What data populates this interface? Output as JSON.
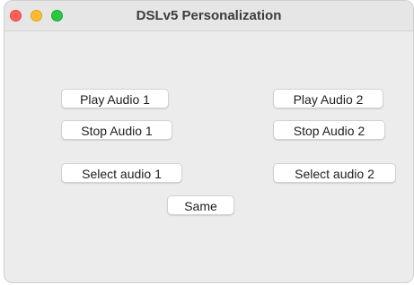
{
  "window": {
    "title": "DSLv5 Personalization"
  },
  "buttons": {
    "play_audio_1": "Play Audio 1",
    "play_audio_2": "Play Audio 2",
    "stop_audio_1": "Stop Audio 1",
    "stop_audio_2": "Stop Audio 2",
    "select_audio_1": "Select audio 1",
    "select_audio_2": "Select audio 2",
    "same": "Same"
  },
  "traffic_lights": {
    "close": {
      "icon": "close-icon",
      "color": "#ff5f57"
    },
    "minimize": {
      "icon": "minimize-icon",
      "color": "#febc2e"
    },
    "zoom": {
      "icon": "zoom-icon",
      "color": "#28c840"
    }
  }
}
